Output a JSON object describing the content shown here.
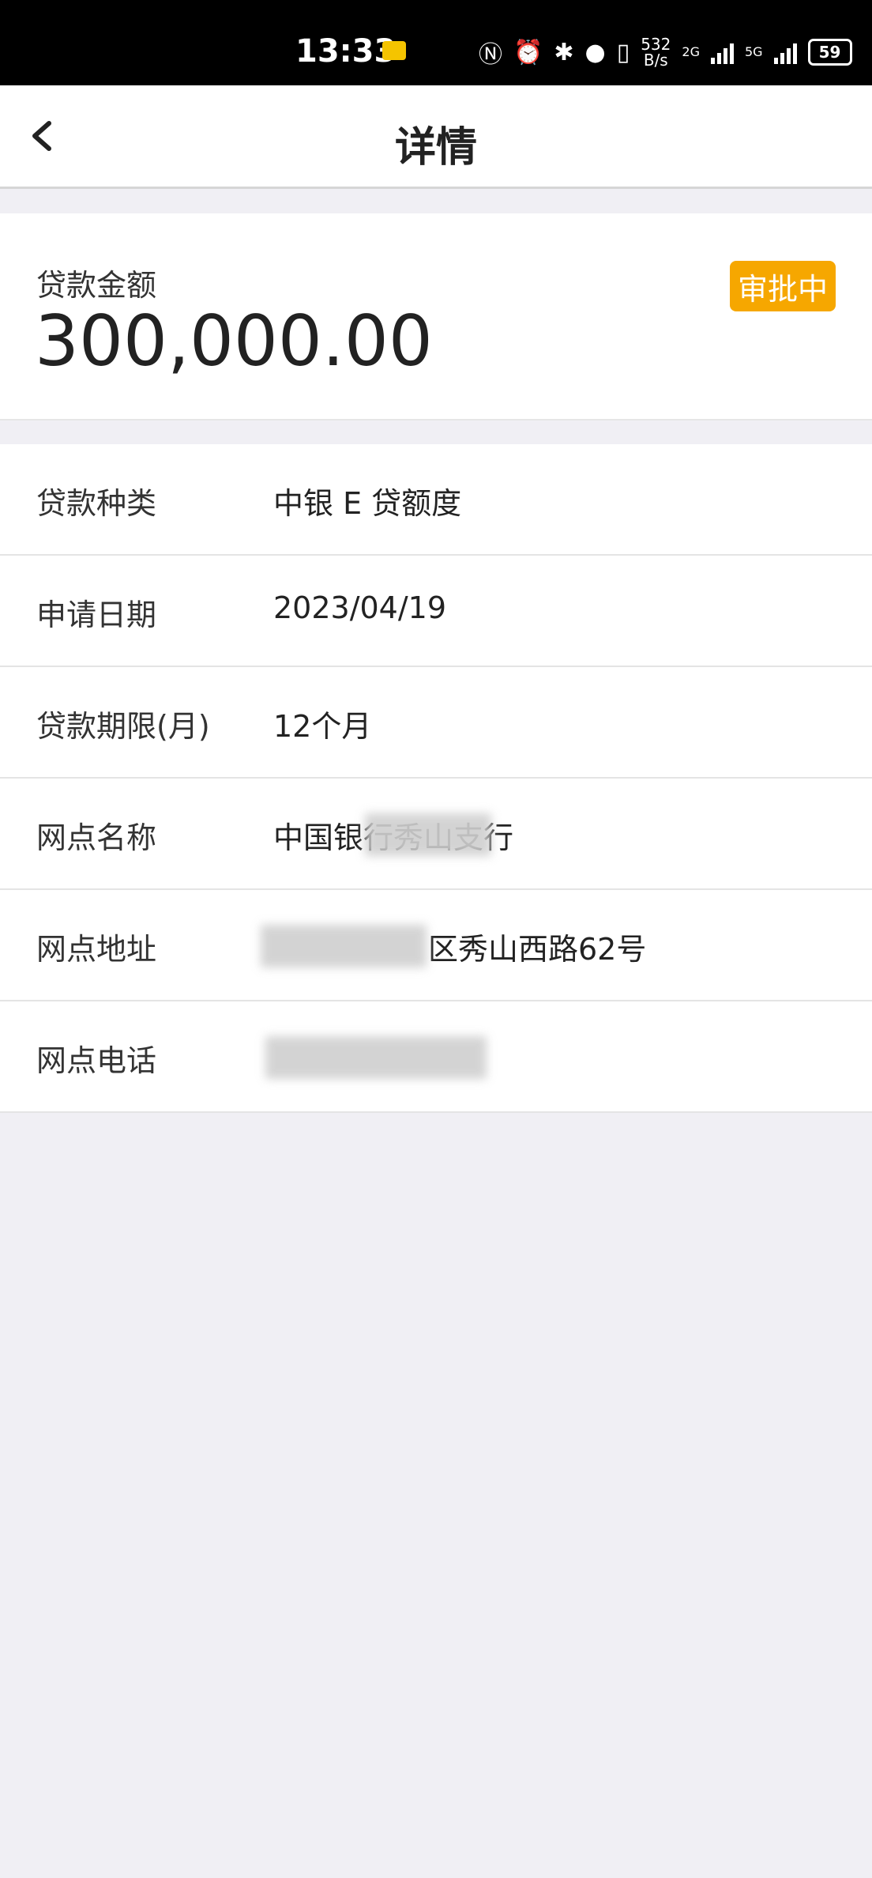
{
  "status_bar": {
    "time": "13:33",
    "net_rate": "532",
    "net_unit": "B/s",
    "net_type_1": "2G",
    "net_type_2": "5G",
    "battery": "59",
    "icons": [
      "mail-icon",
      "nfc-icon",
      "alarm-icon",
      "bluetooth-icon",
      "location-icon",
      "vibrate-icon",
      "signal-icon",
      "battery-icon"
    ]
  },
  "nav": {
    "title": "详情"
  },
  "loan": {
    "amount_label": "贷款金额",
    "amount_value": "300,000.00",
    "status": "审批中",
    "status_color": "#f6a700"
  },
  "details": [
    {
      "label": "贷款种类",
      "value": "中银 E 贷额度"
    },
    {
      "label": "申请日期",
      "value": "2023/04/19"
    },
    {
      "label": "贷款期限(月)",
      "value": "12个月"
    },
    {
      "label": "网点名称",
      "value": "中国银行秀山支行"
    },
    {
      "label": "网点地址",
      "value": "区秀山西路62号"
    },
    {
      "label": "网点电话",
      "value": ""
    }
  ]
}
